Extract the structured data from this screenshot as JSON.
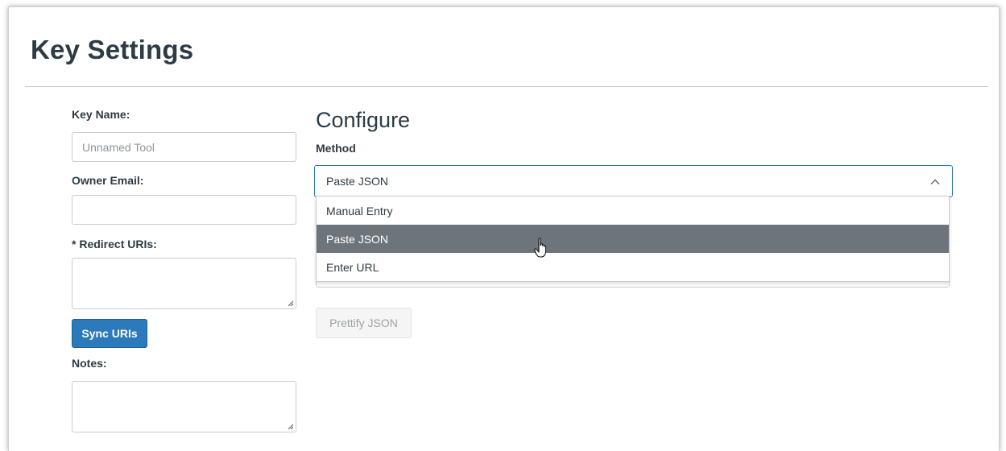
{
  "header": {
    "title": "Key Settings"
  },
  "left_form": {
    "key_name": {
      "label": "Key Name:",
      "placeholder": "Unnamed Tool",
      "value": ""
    },
    "owner_email": {
      "label": "Owner Email:",
      "value": ""
    },
    "redirect_uris": {
      "label": "* Redirect URIs:",
      "value": ""
    },
    "sync_button": "Sync URIs",
    "notes": {
      "label": "Notes:",
      "value": ""
    }
  },
  "configure": {
    "title": "Configure",
    "method_label": "Method",
    "selected_method": "Paste JSON",
    "options": [
      {
        "label": "Manual Entry",
        "selected": false
      },
      {
        "label": "Paste JSON",
        "selected": true
      },
      {
        "label": "Enter URL",
        "selected": false
      }
    ],
    "prettify_button": "Prettify JSON"
  },
  "colors": {
    "primary": "#2b7abc",
    "text": "#2d3b45",
    "selected_option_bg": "#6d757b",
    "border": "#c7cdd1"
  },
  "icons": [
    "chevron-up-icon",
    "pointer-cursor-icon",
    "resize-grip-icon"
  ]
}
